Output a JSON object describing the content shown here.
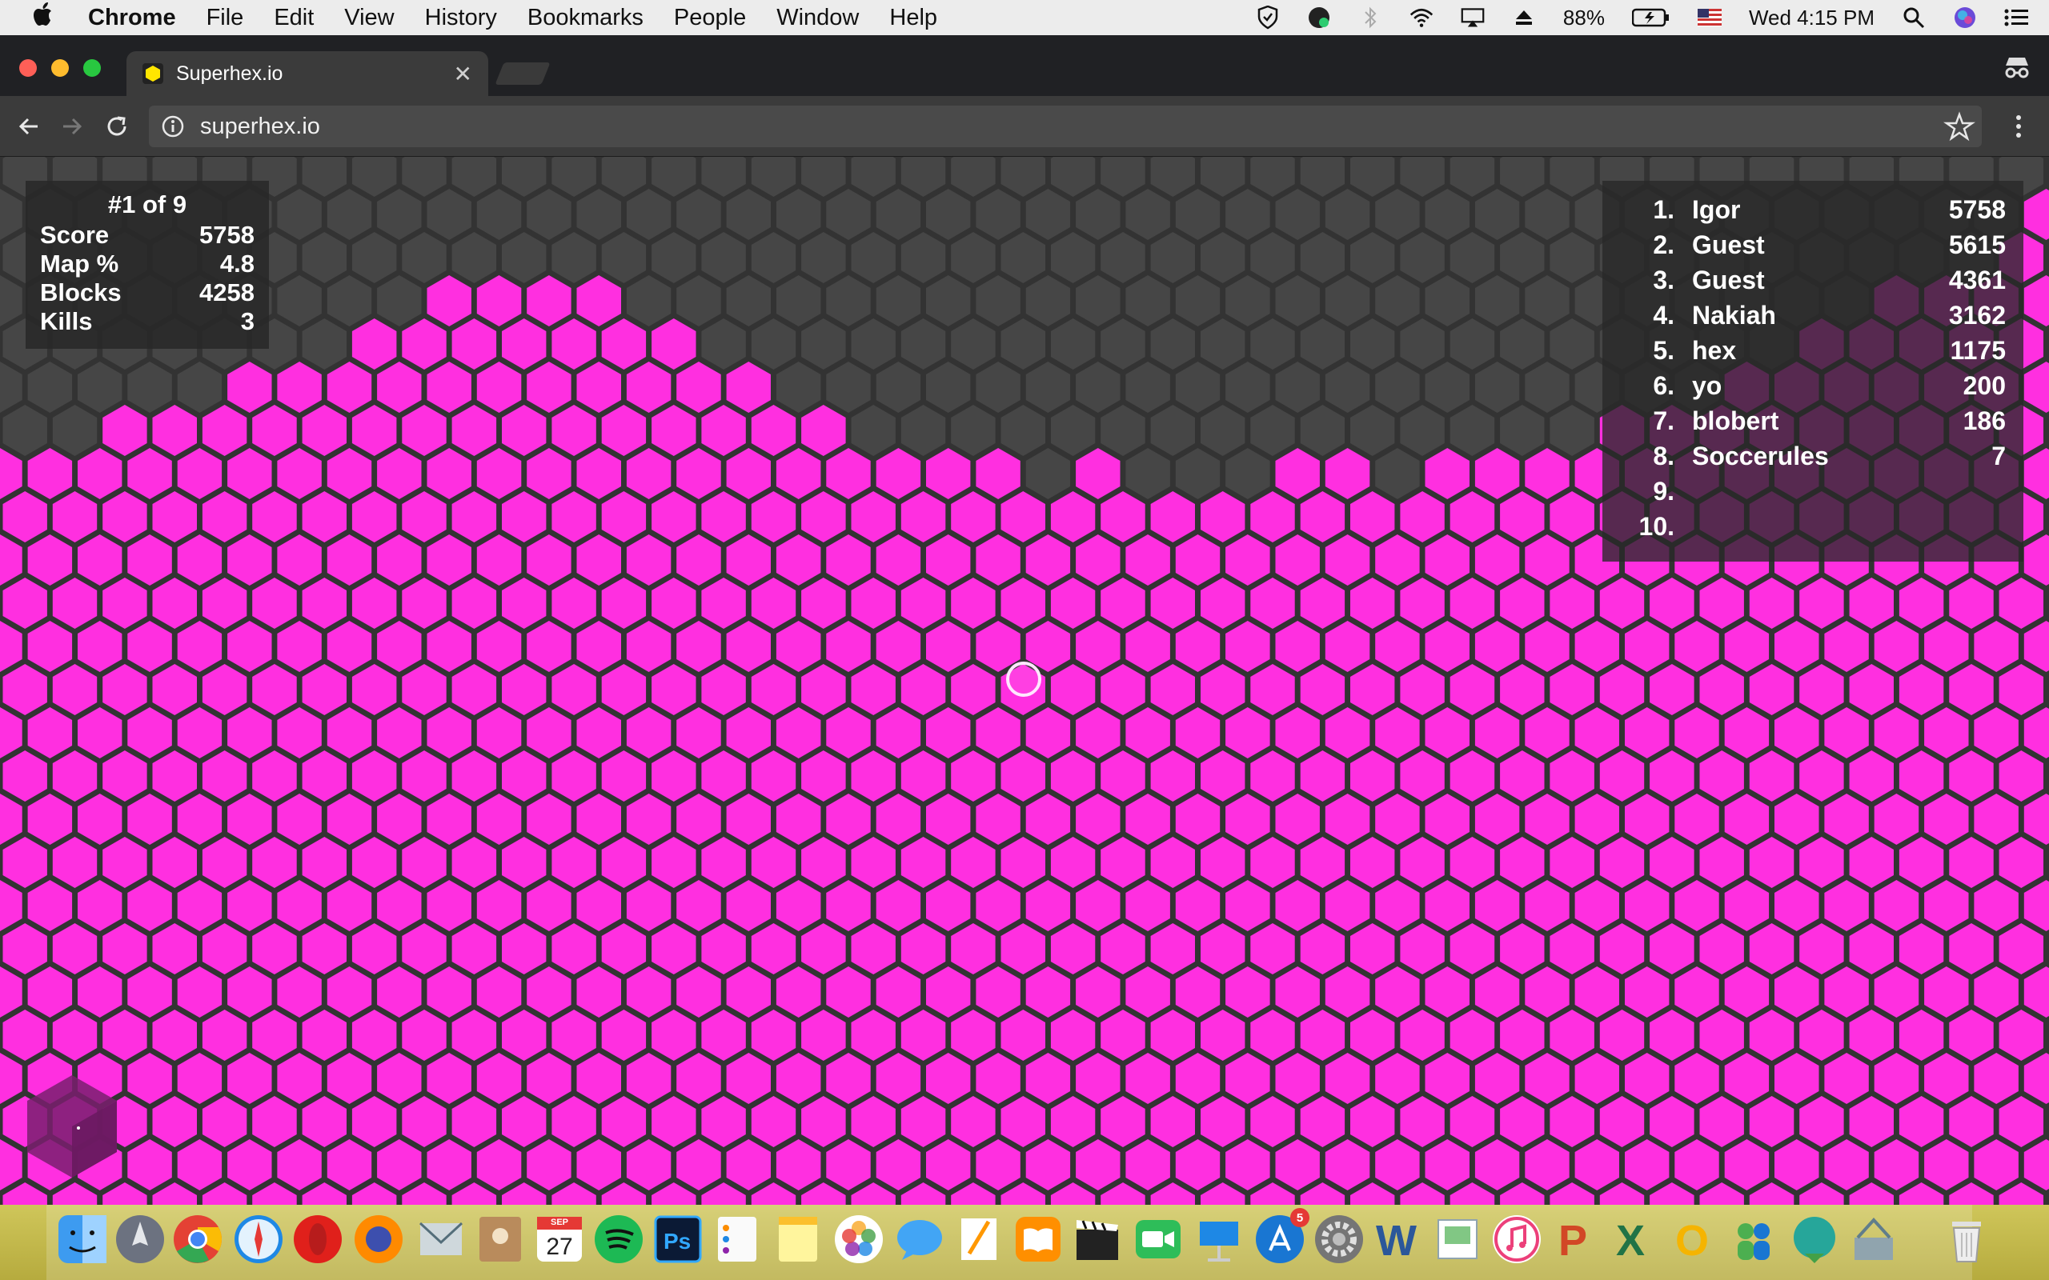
{
  "menubar": {
    "app_name": "Chrome",
    "items": [
      "File",
      "Edit",
      "View",
      "History",
      "Bookmarks",
      "People",
      "Window",
      "Help"
    ],
    "battery": "88%",
    "clock": "Wed 4:15 PM"
  },
  "browser": {
    "tab_title": "Superhex.io",
    "url": "superhex.io"
  },
  "stats": {
    "rank": "#1 of 9",
    "rows": [
      {
        "label": "Score",
        "value": "5758"
      },
      {
        "label": "Map %",
        "value": "4.8"
      },
      {
        "label": "Blocks",
        "value": "4258"
      },
      {
        "label": "Kills",
        "value": "3"
      }
    ]
  },
  "leaderboard": [
    {
      "rank": "1.",
      "name": "Igor",
      "score": "5758"
    },
    {
      "rank": "2.",
      "name": "Guest",
      "score": "5615"
    },
    {
      "rank": "3.",
      "name": "Guest",
      "score": "4361"
    },
    {
      "rank": "4.",
      "name": "Nakiah",
      "score": "3162"
    },
    {
      "rank": "5.",
      "name": "hex",
      "score": "1175"
    },
    {
      "rank": "6.",
      "name": "yo",
      "score": "200"
    },
    {
      "rank": "7.",
      "name": "blobert",
      "score": "186"
    },
    {
      "rank": "8.",
      "name": "Soccerules",
      "score": "7"
    },
    {
      "rank": "9.",
      "name": "",
      "score": ""
    },
    {
      "rank": "10.",
      "name": "",
      "score": ""
    }
  ],
  "colors": {
    "territory": "#ff2fe0",
    "empty_hex": "#464646",
    "grid": "#333333"
  },
  "dock": {
    "calendar_month": "SEP",
    "calendar_day": "27",
    "app_store_badge": "5",
    "icons": [
      "finder-icon",
      "launchpad-icon",
      "chrome-icon",
      "safari-icon",
      "opera-icon",
      "firefox-icon",
      "mail-icon",
      "contacts-icon",
      "calendar-icon",
      "spotify-icon",
      "photoshop-icon",
      "reminders-icon",
      "notes-icon",
      "photos-icon",
      "messages-icon",
      "textedit-icon",
      "ibooks-icon",
      "imovie-icon",
      "facetime-icon",
      "keynote-icon",
      "app-store-icon",
      "system-preferences-icon",
      "word-icon",
      "preview-icon",
      "itunes-icon",
      "powerpoint-icon",
      "excel-icon",
      "outlook-icon",
      "lync-icon",
      "network-icon",
      "bootcamp-icon",
      "trash-icon"
    ]
  }
}
